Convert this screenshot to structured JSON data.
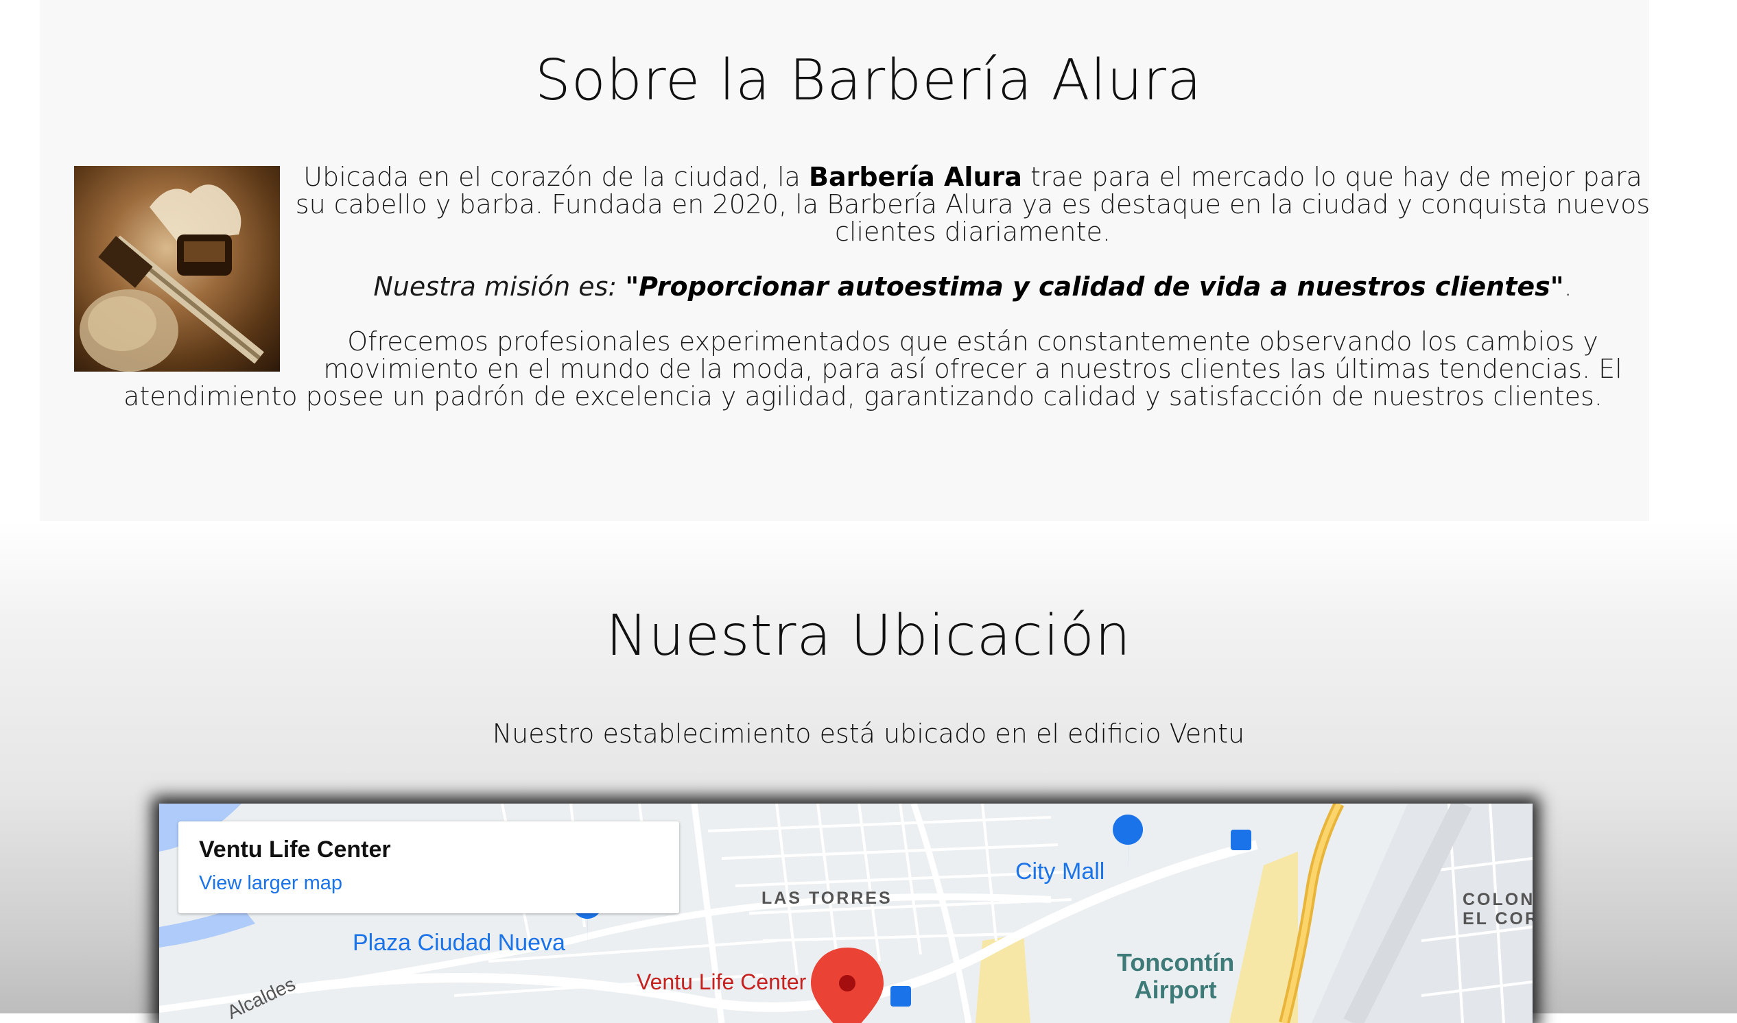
{
  "about": {
    "title": "Sobre la Barbería Alura",
    "image_alt": "brocha y navaja de afeitar",
    "p1_before": "Ubicada en el corazón de la ciudad, la ",
    "p1_bold": "Barbería Alura",
    "p1_after": " trae para el mercado lo que hay de mejor para su cabello y barba. Fundada en 2020, la Barbería Alura ya es destaque en la ciudad y conquista nuevos clientes diariamente.",
    "mission_label": "Nuestra misión es: ",
    "mission_text": "\"Proporcionar autoestima y calidad de vida a nuestros clientes\"",
    "mission_end": ".",
    "p3": "Ofrecemos profesionales experimentados que están constantemente observando los cambios y movimiento en el mundo de la moda, para así ofrecer a nuestros clientes las últimas tendencias. El atendimiento posee un padrón de excelencia y agilidad, garantizando calidad y satisfacción de nuestros clientes."
  },
  "location": {
    "title": "Nuestra Ubicación",
    "description": "Nuestro establecimiento está ubicado en el edificio Ventu"
  },
  "map": {
    "card_place": "Ventu Life Center",
    "card_link": "View larger map",
    "labels": {
      "las_torres": "LAS TORRES",
      "city_mall": "City Mall",
      "plaza": "Plaza Ciudad Nueva",
      "ventu": "Ventu Life Center",
      "airport_line1": "Toncontín",
      "airport_line2": "Airport",
      "colon_line1": "COLON",
      "colon_line2": "EL CORT",
      "alcaldes": "Alcaldes"
    },
    "colors": {
      "marker": "#ea4335",
      "poi": "#1a73e8",
      "highway": "#f5c242",
      "water": "#aecbfa"
    }
  }
}
